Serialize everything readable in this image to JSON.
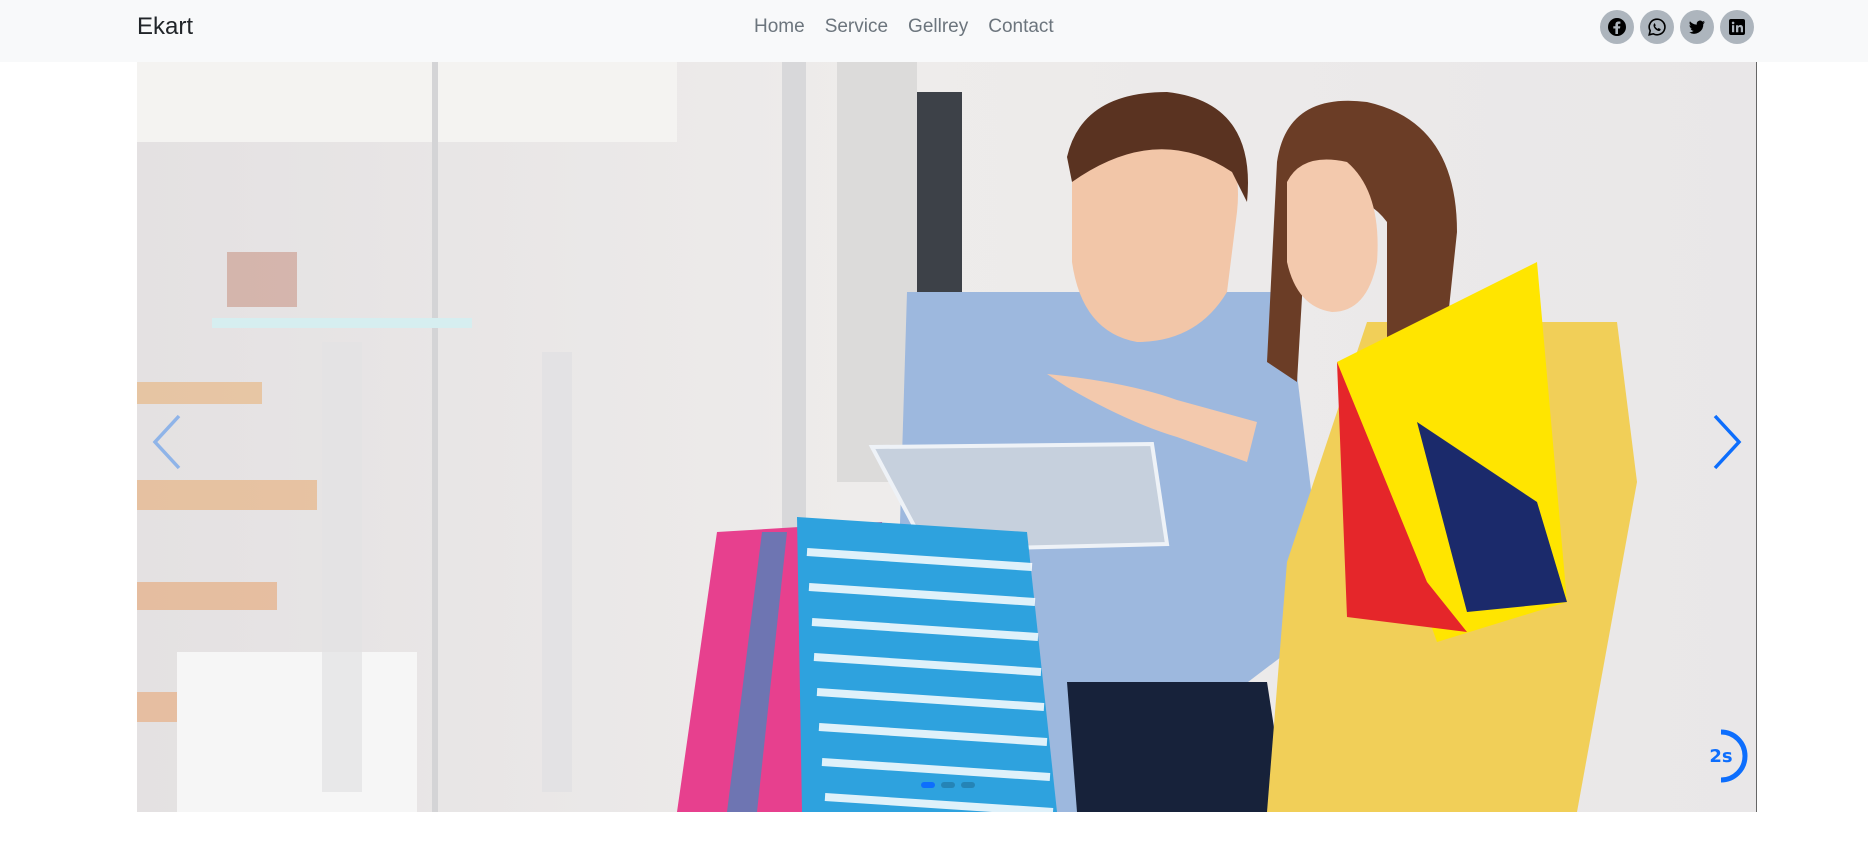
{
  "navbar": {
    "brand": "Ekart",
    "links": [
      {
        "label": "Home"
      },
      {
        "label": "Service"
      },
      {
        "label": "Gellrey"
      },
      {
        "label": "Contact"
      }
    ],
    "social_icons": [
      "facebook-icon",
      "whatsapp-icon",
      "twitter-icon",
      "linkedin-icon"
    ]
  },
  "carousel": {
    "slide_image": "couple-shopping-with-bags-and-tablet",
    "slide_count": 3,
    "active_slide": 1,
    "timer_label": "2s",
    "accent_color": "#0d6efd"
  }
}
